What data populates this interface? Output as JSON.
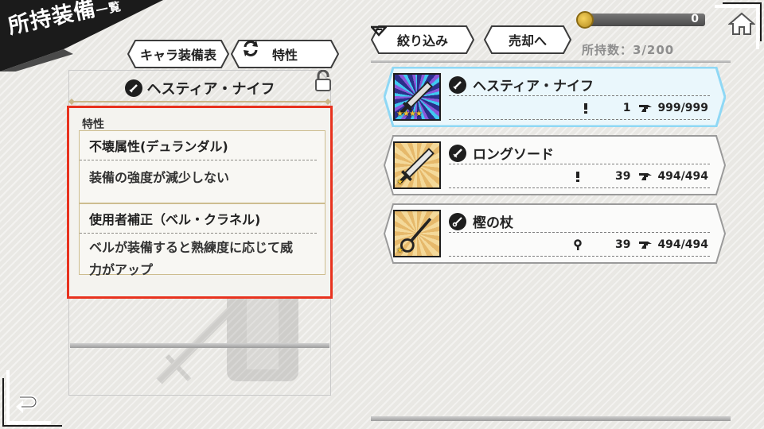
{
  "header": {
    "title": "所持装備",
    "title_suffix": "一覧"
  },
  "tabs": {
    "character_equipment": "キャラ装備表",
    "traits": "特性"
  },
  "toolbar": {
    "filter": "絞り込み",
    "sell": "売却へ"
  },
  "currency": {
    "value": "0",
    "icon": "coin-icon"
  },
  "inventory": {
    "owned_label": "所持数：3/200"
  },
  "detail": {
    "item_name": "ヘスティア・ナイフ",
    "item_icon": "dagger-icon",
    "locked": false,
    "traits_caption": "特性",
    "traits": [
      {
        "name": "不壊属性(デュランダル)",
        "description_lines": [
          "装備の強度が減少しない",
          ""
        ]
      },
      {
        "name": "使用者補正（ベル・クラネル)",
        "description_lines": [
          "ベルが装備すると熟練度に応じて威",
          "力がアップ"
        ]
      }
    ]
  },
  "equipment_list": [
    {
      "name": "ヘスティア・ナイフ",
      "type_icon": "dagger-icon",
      "stat_icon": "strength-icon",
      "stat_value": "1",
      "durability": "999/999",
      "stars": 4,
      "selected": true,
      "thumb_style": "rare"
    },
    {
      "name": "ロングソード",
      "type_icon": "sword-icon",
      "stat_icon": "strength-icon",
      "stat_value": "39",
      "durability": "494/494",
      "stars": 1,
      "selected": false,
      "thumb_style": "gold"
    },
    {
      "name": "樫の杖",
      "type_icon": "staff-icon",
      "stat_icon": "magic-icon",
      "stat_value": "39",
      "durability": "494/494",
      "stars": 1,
      "selected": false,
      "thumb_style": "gold"
    }
  ],
  "colors": {
    "highlight_border": "#e8321e",
    "selected_card_glow": "#8fd8f5",
    "accent_gold": "#c9b88a"
  }
}
